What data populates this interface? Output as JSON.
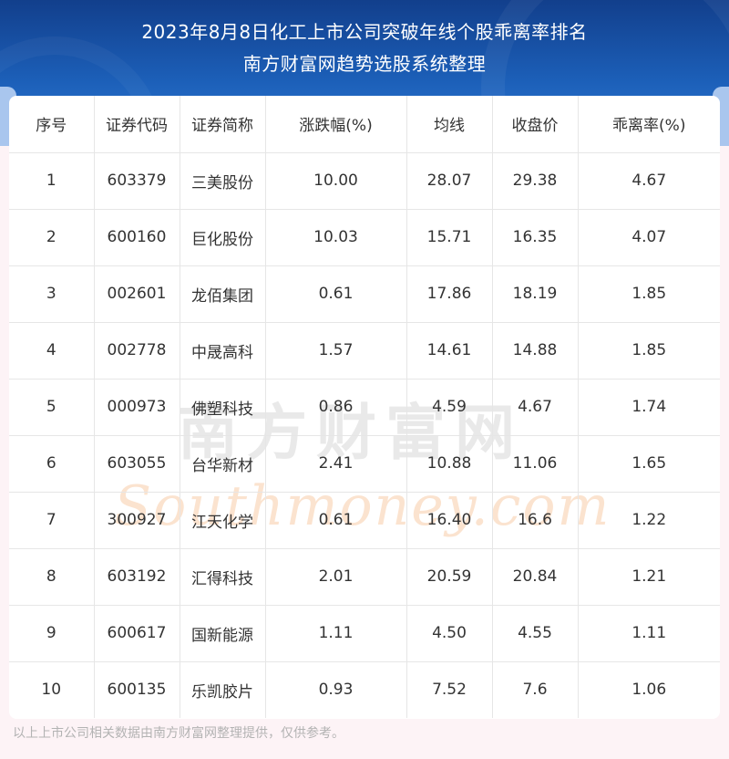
{
  "header": {
    "title": "2023年8月8日化工上市公司突破年线个股乖离率排名",
    "subtitle": "南方财富网趋势选股系统整理"
  },
  "table": {
    "columns": [
      "序号",
      "证券代码",
      "证券简称",
      "涨跌幅(%)",
      "均线",
      "收盘价",
      "乖离率(%)"
    ],
    "rows": [
      [
        "1",
        "603379",
        "三美股份",
        "10.00",
        "28.07",
        "29.38",
        "4.67"
      ],
      [
        "2",
        "600160",
        "巨化股份",
        "10.03",
        "15.71",
        "16.35",
        "4.07"
      ],
      [
        "3",
        "002601",
        "龙佰集团",
        "0.61",
        "17.86",
        "18.19",
        "1.85"
      ],
      [
        "4",
        "002778",
        "中晟高科",
        "1.57",
        "14.61",
        "14.88",
        "1.85"
      ],
      [
        "5",
        "000973",
        "佛塑科技",
        "0.86",
        "4.59",
        "4.67",
        "1.74"
      ],
      [
        "6",
        "603055",
        "台华新材",
        "2.41",
        "10.88",
        "11.06",
        "1.65"
      ],
      [
        "7",
        "300927",
        "江天化学",
        "0.61",
        "16.40",
        "16.6",
        "1.22"
      ],
      [
        "8",
        "603192",
        "汇得科技",
        "2.01",
        "20.59",
        "20.84",
        "1.21"
      ],
      [
        "9",
        "600617",
        "国新能源",
        "1.11",
        "4.50",
        "4.55",
        "1.11"
      ],
      [
        "10",
        "600135",
        "乐凯胶片",
        "0.93",
        "7.52",
        "7.6",
        "1.06"
      ]
    ]
  },
  "watermark": {
    "cn": "南方财富网",
    "en": "Southmoney.com"
  },
  "footnote": "以上上市公司相关数据由南方财富网整理提供，仅供参考。"
}
